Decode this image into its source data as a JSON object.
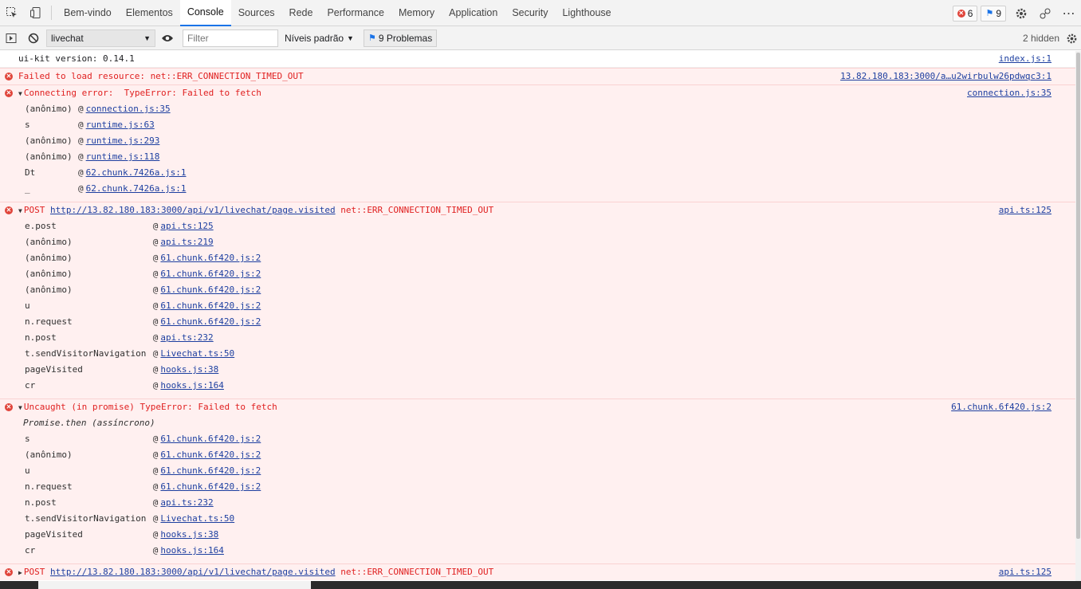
{
  "tabs": [
    {
      "label": "Bem-vindo",
      "active": false
    },
    {
      "label": "Elementos",
      "active": false
    },
    {
      "label": "Console",
      "active": true
    },
    {
      "label": "Sources",
      "active": false
    },
    {
      "label": "Rede",
      "active": false
    },
    {
      "label": "Performance",
      "active": false
    },
    {
      "label": "Memory",
      "active": false
    },
    {
      "label": "Application",
      "active": false
    },
    {
      "label": "Security",
      "active": false
    },
    {
      "label": "Lighthouse",
      "active": false
    }
  ],
  "badges": {
    "errors": "6",
    "issues": "9"
  },
  "toolbar": {
    "context": "livechat",
    "filter_placeholder": "Filter",
    "levels": "Níveis padrão",
    "problems": "9 Problemas",
    "hidden": "2 hidden"
  },
  "messages": [
    {
      "type": "info",
      "text": "ui-kit version: 0.14.1",
      "source": "index.js:1"
    },
    {
      "type": "error",
      "text": "Failed to load resource: net::ERR_CONNECTION_TIMED_OUT",
      "source": "13.82.180.183:3000/a…u2wirbulw26pdwqc3:1"
    },
    {
      "type": "error",
      "expanded": true,
      "text": "Connecting error:  TypeError: Failed to fetch",
      "source": "connection.js:35",
      "stack": [
        {
          "fn": "(anônimo)",
          "link": "connection.js:35"
        },
        {
          "fn": "s",
          "link": "runtime.js:63"
        },
        {
          "fn": "(anônimo)",
          "link": "runtime.js:293"
        },
        {
          "fn": "(anônimo)",
          "link": "runtime.js:118"
        },
        {
          "fn": "Dt",
          "link": "62.chunk.7426a.js:1"
        },
        {
          "fn": "_",
          "link": "62.chunk.7426a.js:1"
        }
      ]
    },
    {
      "type": "error",
      "expanded": true,
      "prefix": "POST ",
      "url": "http://13.82.180.183:3000/api/v1/livechat/page.visited",
      "suffix": " net::ERR_CONNECTION_TIMED_OUT",
      "source": "api.ts:125",
      "stack": [
        {
          "fn": "e.post",
          "link": "api.ts:125"
        },
        {
          "fn": "(anônimo)",
          "link": "api.ts:219"
        },
        {
          "fn": "(anônimo)",
          "link": "61.chunk.6f420.js:2"
        },
        {
          "fn": "(anônimo)",
          "link": "61.chunk.6f420.js:2"
        },
        {
          "fn": "(anônimo)",
          "link": "61.chunk.6f420.js:2"
        },
        {
          "fn": "u",
          "link": "61.chunk.6f420.js:2"
        },
        {
          "fn": "n.request",
          "link": "61.chunk.6f420.js:2"
        },
        {
          "fn": "n.post",
          "link": "api.ts:232"
        },
        {
          "fn": "t.sendVisitorNavigation",
          "link": "Livechat.ts:50"
        },
        {
          "fn": "pageVisited",
          "link": "hooks.js:38"
        },
        {
          "fn": "cr",
          "link": "hooks.js:164"
        }
      ]
    },
    {
      "type": "error",
      "expanded": true,
      "text": "Uncaught (in promise) TypeError: Failed to fetch",
      "source": "61.chunk.6f420.js:2",
      "note": "Promise.then (assíncrono)",
      "stack": [
        {
          "fn": "s",
          "link": "61.chunk.6f420.js:2"
        },
        {
          "fn": "(anônimo)",
          "link": "61.chunk.6f420.js:2"
        },
        {
          "fn": "u",
          "link": "61.chunk.6f420.js:2"
        },
        {
          "fn": "n.request",
          "link": "61.chunk.6f420.js:2"
        },
        {
          "fn": "n.post",
          "link": "api.ts:232"
        },
        {
          "fn": "t.sendVisitorNavigation",
          "link": "Livechat.ts:50"
        },
        {
          "fn": "pageVisited",
          "link": "hooks.js:38"
        },
        {
          "fn": "cr",
          "link": "hooks.js:164"
        }
      ]
    },
    {
      "type": "error",
      "expanded": false,
      "prefix": "POST ",
      "url": "http://13.82.180.183:3000/api/v1/livechat/page.visited",
      "suffix": " net::ERR_CONNECTION_TIMED_OUT",
      "source": "api.ts:125"
    }
  ]
}
